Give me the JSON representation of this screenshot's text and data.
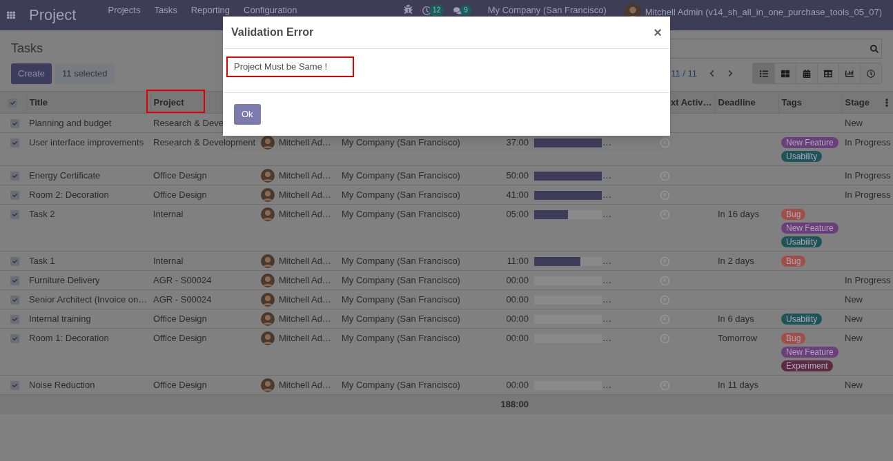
{
  "navbar": {
    "app_title": "Project",
    "menu": [
      "Projects",
      "Tasks",
      "Reporting",
      "Configuration"
    ],
    "activity_count": "12",
    "message_count": "9",
    "company": "My Company (San Francisco)",
    "user": "Mitchell Admin (v14_sh_all_in_one_purchase_tools_05_07)"
  },
  "control_panel": {
    "title": "Tasks",
    "create": "Create",
    "selection": "11 selected",
    "pager": "11 / 11",
    "views": [
      {
        "kind": "list",
        "selected": true
      },
      {
        "kind": "kanban",
        "selected": false
      },
      {
        "kind": "calendar",
        "selected": false
      },
      {
        "kind": "pivot",
        "selected": false
      },
      {
        "kind": "graph",
        "selected": false
      },
      {
        "kind": "activity",
        "selected": false
      }
    ]
  },
  "table": {
    "all_checked": true,
    "header": {
      "title": "Title",
      "project": "Project",
      "next_activity": "xt Activ…",
      "deadline": "Deadline",
      "tags": "Tags",
      "stage": "Stage"
    },
    "rows": [
      {
        "checked": true,
        "title": "Planning and budget",
        "project": "Research & Deve",
        "stage": "New"
      },
      {
        "checked": true,
        "title": "User interface improvements",
        "project": "Research & Development",
        "assignee": "Mitchell Ad…",
        "company": "My Company (San Francisco)",
        "planned": "37:00",
        "level": 1,
        "progress_text": "…",
        "tags": [
          {
            "label": "New Feature",
            "color": "#6b3f7c"
          },
          {
            "label": "Usability",
            "color": "#1d5458"
          }
        ],
        "stage": "In Progress"
      },
      {
        "checked": true,
        "title": "Energy Certificate",
        "project": "Office Design",
        "assignee": "Mitchell Ad…",
        "company": "My Company (San Francisco)",
        "planned": "50:00",
        "level": 1,
        "progress_text": "…",
        "stage": "In Progress"
      },
      {
        "checked": true,
        "title": "Room 2: Decoration",
        "project": "Office Design",
        "assignee": "Mitchell Ad…",
        "company": "My Company (San Francisco)",
        "planned": "41:00",
        "level": 1,
        "progress_text": "…",
        "stage": "In Progress"
      },
      {
        "checked": true,
        "title": "Task 2",
        "project": "Internal",
        "assignee": "Mitchell Ad…",
        "company": "My Company (San Francisco)",
        "planned": "05:00",
        "level": 0.5,
        "progress_text": "…",
        "deadline": "In 16 days",
        "tags": [
          {
            "label": "Bug",
            "color": "#a04e48"
          },
          {
            "label": "New Feature",
            "color": "#6b3f7c"
          },
          {
            "label": "Usability",
            "color": "#1d5458"
          }
        ]
      },
      {
        "checked": true,
        "title": "Task 1",
        "project": "Internal",
        "assignee": "Mitchell Ad…",
        "company": "My Company (San Francisco)",
        "planned": "11:00",
        "level": 0.68,
        "progress_text": "…",
        "deadline": "In 2 days",
        "tags": [
          {
            "label": "Bug",
            "color": "#a04e48"
          }
        ]
      },
      {
        "checked": true,
        "title": "Furniture Delivery",
        "project": "AGR - S00024",
        "assignee": "Mitchell Ad…",
        "company": "My Company (San Francisco)",
        "planned": "00:00",
        "level": 0,
        "progress_text": "…",
        "stage": "In Progress"
      },
      {
        "checked": true,
        "title": "Senior Architect (Invoice on…",
        "project": "AGR - S00024",
        "assignee": "Mitchell Ad…",
        "company": "My Company (San Francisco)",
        "planned": "00:00",
        "level": 0,
        "progress_text": "…",
        "stage": "New"
      },
      {
        "checked": true,
        "title": "Internal training",
        "project": "Office Design",
        "assignee": "Mitchell Ad…",
        "company": "My Company (San Francisco)",
        "planned": "00:00",
        "level": 0,
        "progress_text": "…",
        "deadline": "In 6 days",
        "tags": [
          {
            "label": "Usability",
            "color": "#1d5458"
          }
        ],
        "stage": "New"
      },
      {
        "checked": true,
        "title": "Room 1: Decoration",
        "project": "Office Design",
        "assignee": "Mitchell Ad…",
        "company": "My Company (San Francisco)",
        "planned": "00:00",
        "level": 0,
        "progress_text": "…",
        "deadline": "Tomorrow",
        "tags": [
          {
            "label": "Bug",
            "color": "#a04e48"
          },
          {
            "label": "New Feature",
            "color": "#6b3f7c"
          },
          {
            "label": "Experiment",
            "color": "#5a2b42"
          }
        ],
        "stage": "New"
      },
      {
        "checked": true,
        "title": "Noise Reduction",
        "project": "Office Design",
        "assignee": "Mitchell Ad…",
        "company": "My Company (San Francisco)",
        "planned": "00:00",
        "level": 0,
        "progress_text": "…",
        "deadline": "In 11 days",
        "stage": "New"
      }
    ],
    "total_planned": "188:00"
  },
  "dialog": {
    "title": "Validation Error",
    "close": "×",
    "message": "Project Must be Same !",
    "button": "Ok"
  }
}
